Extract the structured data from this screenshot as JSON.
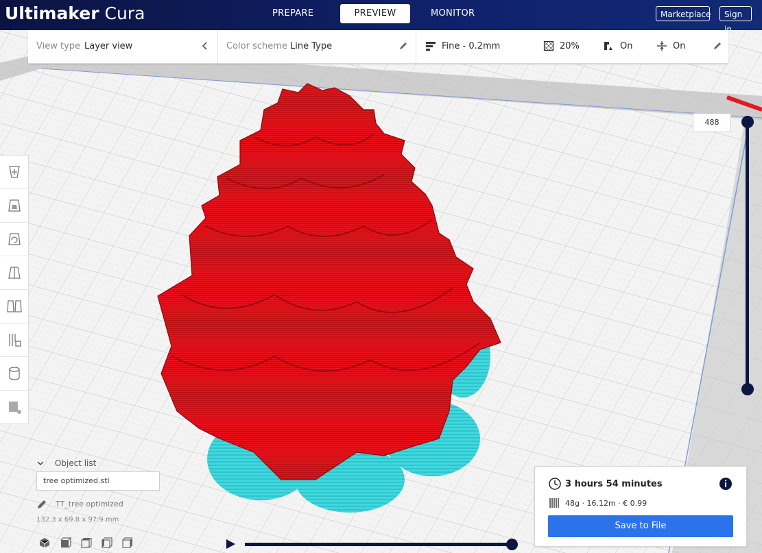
{
  "app": {
    "brand_bold": "Ultimaker",
    "brand_light": " Cura"
  },
  "stages": [
    {
      "label": "PREPARE"
    },
    {
      "label": "PREVIEW"
    },
    {
      "label": "MONITOR"
    }
  ],
  "header_buttons": {
    "marketplace": "Marketplace",
    "sign_in": "Sign in"
  },
  "settings_bar": {
    "view_type_label": "View type",
    "view_type_value": "Layer view",
    "color_scheme_label": "Color scheme",
    "color_scheme_value": "Line Type",
    "profile": "Fine - 0.2mm",
    "infill": "20%",
    "support": "On",
    "adhesion": "On"
  },
  "layer_slider": {
    "current_layer": "488"
  },
  "object_list": {
    "header": "Object list",
    "file_name": "tree optimized.stl",
    "object_name": "TT_tree optimized",
    "dimensions": "132.3 x 69.8 x 97.9 mm"
  },
  "print_info": {
    "time": "3 hours 54 minutes",
    "material": "48g · 16.12m · € 0.99",
    "save_label": "Save to File"
  },
  "colors": {
    "header": "#10206a",
    "accent": "#2a73ea",
    "model": "#e8141a",
    "support": "#38d6dc",
    "slider": "#0d1640"
  },
  "icons": [
    "clock-icon",
    "info-icon",
    "spool-icon",
    "pencil-icon",
    "chevron-left-icon",
    "profile-icon",
    "infill-icon",
    "support-icon",
    "adhesion-icon",
    "play-icon"
  ]
}
